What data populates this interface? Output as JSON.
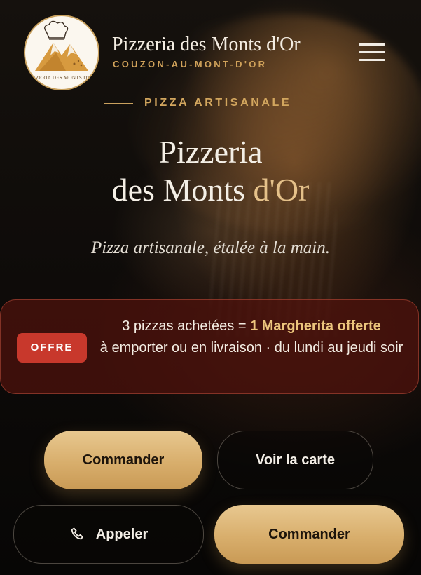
{
  "header": {
    "logo_text": "PIZZERIA DES MONTS D'OR",
    "brand_name": "Pizzeria des Monts d'Or",
    "brand_location": "COUZON-AU-MONT-D'OR",
    "menu_icon": "hamburger-menu-icon"
  },
  "hero": {
    "eyebrow": "PIZZA ARTISANALE",
    "title_line1": "Pizzeria",
    "title_line2_start": "des Monts ",
    "title_line2_accent": "d'Or",
    "tagline": "Pizza artisanale, étalée à la main."
  },
  "offer": {
    "badge": "OFFRE",
    "text_start": "3 pizzas achetées = ",
    "text_highlight": "1 Margherita offerte",
    "text_rest": "à emporter ou en livraison · du lundi au jeudi soir"
  },
  "actions": {
    "order_label": "Commander",
    "menu_label": "Voir la carte",
    "call_label": "Appeler",
    "call_icon": "phone-icon",
    "order_label_2": "Commander"
  },
  "colors": {
    "gold": "#d8ae6c",
    "accent_text": "#d0a25a",
    "offer_badge": "#c8382c",
    "background": "#0b0907"
  }
}
